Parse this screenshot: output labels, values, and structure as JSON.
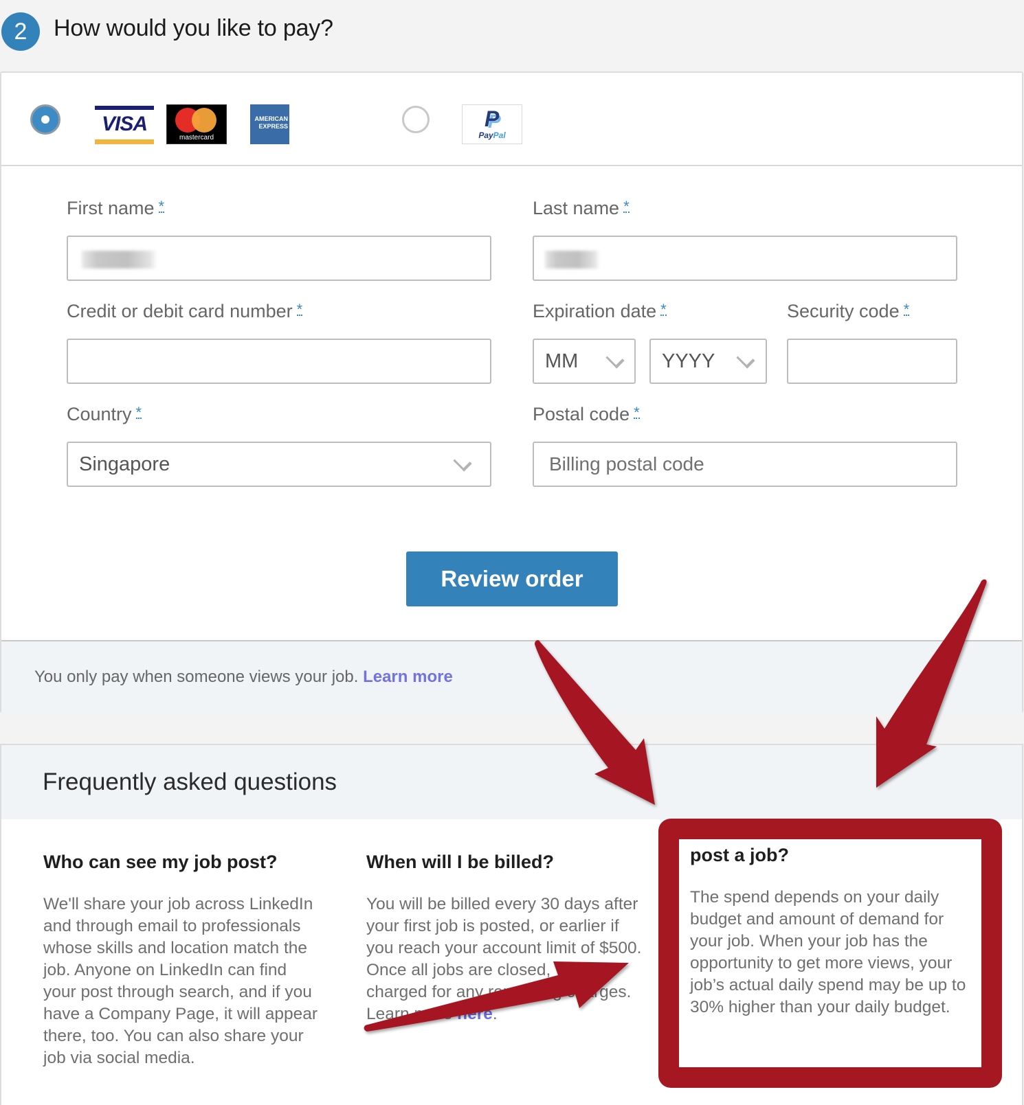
{
  "step": {
    "number": "2",
    "title": "How would you like to pay?"
  },
  "payment_methods": {
    "card": {
      "selected": true,
      "brands": [
        {
          "name": "Visa",
          "label": "VISA"
        },
        {
          "name": "Mastercard",
          "label": "mastercard"
        },
        {
          "name": "American Express",
          "label_line1": "AMERICAN",
          "label_line2": "EXPRESS"
        }
      ]
    },
    "paypal": {
      "selected": false,
      "label_pay": "Pay",
      "label_pal": "Pal",
      "glyph": "P"
    }
  },
  "form": {
    "required_marker": "*",
    "first_name": {
      "label": "First name",
      "value": "[redacted]"
    },
    "last_name": {
      "label": "Last name",
      "value": "[redacted]"
    },
    "card_number": {
      "label": "Credit or debit card number",
      "value": ""
    },
    "expiration": {
      "label": "Expiration date",
      "month": "MM",
      "year": "YYYY"
    },
    "security_code": {
      "label": "Security code",
      "value": ""
    },
    "country": {
      "label": "Country",
      "value": "Singapore"
    },
    "postal_code": {
      "label": "Postal code",
      "placeholder": "Billing postal code"
    },
    "submit_label": "Review order"
  },
  "footer_note": {
    "text": "You only pay when someone views your job.",
    "link": "Learn more"
  },
  "faq": {
    "title": "Frequently asked questions",
    "items": [
      {
        "question": "Who can see my job post?",
        "answer": "We'll share your job across LinkedIn and through email to professionals whose skills and location match the job. Anyone on LinkedIn can find your post through search, and if you have a Company Page, it will appear there, too. You can also share your job via social media."
      },
      {
        "question": "When will I be billed?",
        "answer": "You will be billed every 30 days after your first job is posted, or earlier if you reach your account limit of $500. Once all jobs are closed, you'll be charged for any remaining charges. Learn more",
        "link": "here",
        "answer_end": "."
      },
      {
        "question": "How much will it cost me to post a job?",
        "answer": "The spend depends on your daily budget and amount of demand for your job. When your job has the opportunity to get more views, your job’s actual daily spend may be up to 30% higher than your daily budget."
      }
    ]
  },
  "annotation": {
    "highlight_color": "#a51822",
    "highlighted_item": "How much will it cost me to post a job?"
  },
  "colors": {
    "primary": "#3482ba",
    "link": "#7272e0",
    "required": "#3a8ac2"
  }
}
